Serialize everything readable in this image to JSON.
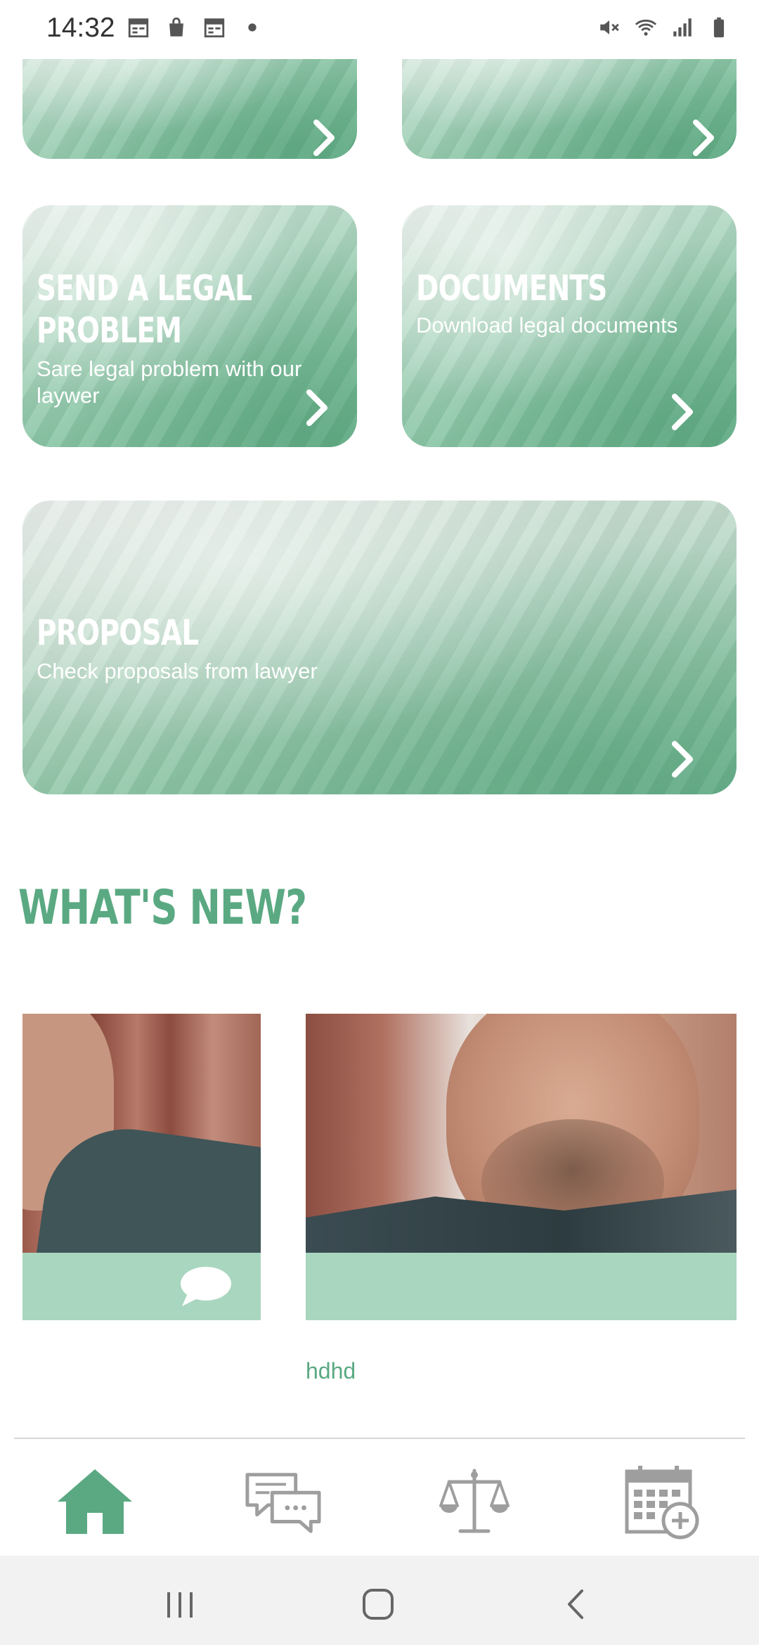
{
  "status_bar": {
    "time": "14:32",
    "left_icons": [
      "calendar-icon",
      "bag-icon",
      "calendar-icon",
      "dot-icon"
    ],
    "right_icons": [
      "mute-icon",
      "wifi-icon",
      "signal-icon",
      "battery-icon"
    ]
  },
  "cards": {
    "send_problem": {
      "title": "SEND A LEGAL PROBLEM",
      "subtitle": "Sare legal problem with our laywer"
    },
    "documents": {
      "title": "DOCUMENTS",
      "subtitle": "Download legal documents"
    },
    "proposal": {
      "title": "PROPOSAL",
      "subtitle": "Check proposals from lawyer"
    }
  },
  "section": {
    "whats_new": "WHAT'S NEW?"
  },
  "news": {
    "items": [
      {
        "label": ""
      },
      {
        "label": "hdhd"
      }
    ]
  },
  "bottom_nav": {
    "items": [
      "home-icon",
      "chat-icon",
      "scales-icon",
      "calendar-add-icon"
    ],
    "active": 0,
    "accent_color": "#5aa982",
    "inactive_color": "#9e9e9e"
  },
  "colors": {
    "brand": "#5aa982",
    "strip": "#a9d6bf"
  }
}
